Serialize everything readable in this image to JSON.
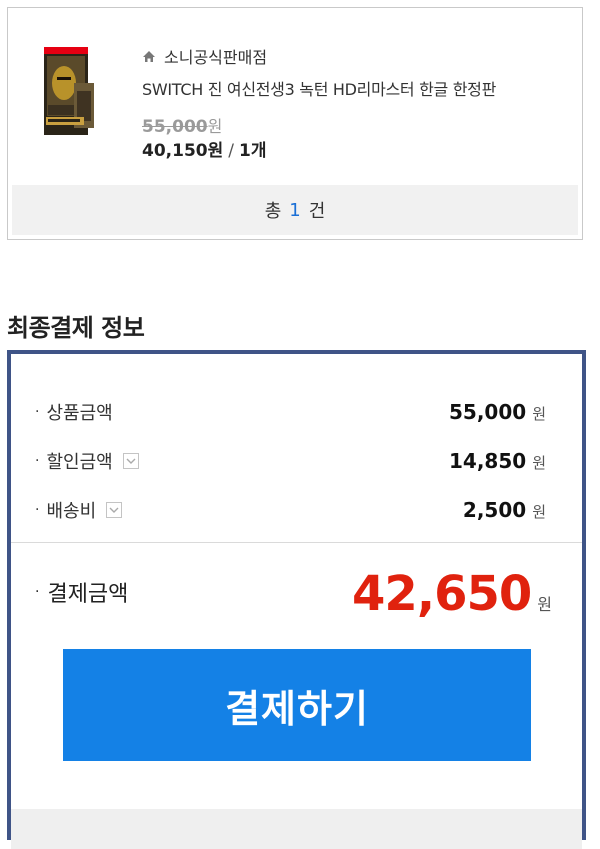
{
  "order": {
    "shop_name": "소니공식판매점",
    "product_name": "SWITCH 진 여신전생3 녹턴 HD리마스터 한글 한정판",
    "original_price": "55,000",
    "original_price_unit": "원",
    "sale_price": "40,150원",
    "separator": "/",
    "quantity": "1개",
    "total_prefix": "총",
    "total_count": "1",
    "total_suffix": "건"
  },
  "section": {
    "title": "최종결제 정보"
  },
  "payment": {
    "rows": [
      {
        "label": "상품금액",
        "value": "55,000",
        "unit": "원"
      },
      {
        "label": "할인금액",
        "value": "14,850",
        "unit": "원"
      },
      {
        "label": "배송비",
        "value": "2,500",
        "unit": "원"
      }
    ],
    "bullet": "·",
    "final_label": "결제금액",
    "final_value": "42,650",
    "final_unit": "원",
    "pay_button_label": "결제하기"
  },
  "colors": {
    "accent_blue": "#1481e6",
    "box_border": "#3f5487",
    "final_amount_red": "#e0220e",
    "count_blue": "#1a6fd6"
  },
  "icons": {
    "shop": "home-icon",
    "toggle": "chevron-down-icon"
  }
}
